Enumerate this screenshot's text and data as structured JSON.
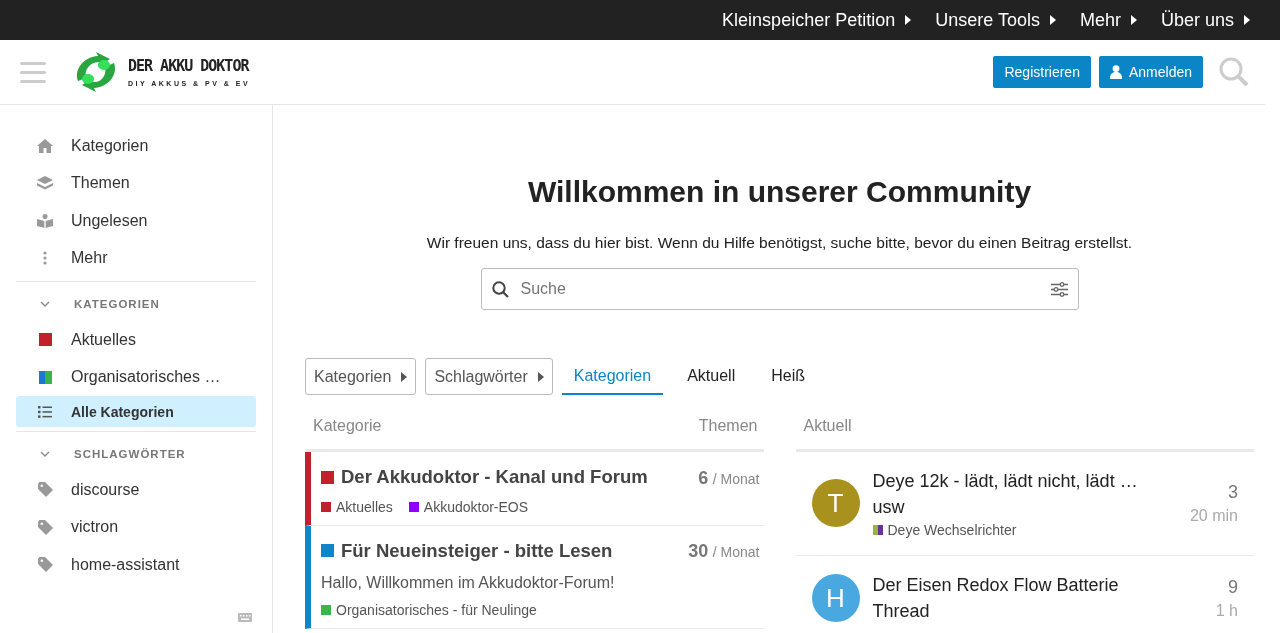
{
  "top_nav": [
    {
      "label": "Kleinspeicher Petition"
    },
    {
      "label": "Unsere Tools"
    },
    {
      "label": "Mehr"
    },
    {
      "label": "Über uns"
    }
  ],
  "header": {
    "logo_title": "DER AKKU DOKTOR",
    "logo_subtitle": "DIY AKKUS & PV & EV",
    "buttons": [
      {
        "label": "Registrieren",
        "kind": "plain"
      },
      {
        "label": "Anmelden",
        "kind": "user"
      }
    ]
  },
  "sidebar": {
    "items": [
      {
        "label": "Kategorien",
        "kind": "home"
      },
      {
        "label": "Themen",
        "kind": "layers"
      },
      {
        "label": "Ungelesen",
        "kind": "book"
      },
      {
        "label": "Mehr",
        "kind": "more"
      }
    ],
    "categories_heading": "KATEGORIEN",
    "categories": [
      {
        "label": "Aktuelles",
        "swatches": [
          {
            "color": "#c3202e"
          }
        ],
        "selected": false
      },
      {
        "label": "Organisatorisches …",
        "swatches": [
          {
            "color": "#1a7ad1"
          },
          {
            "color": "#3ab54a"
          }
        ],
        "selected": false
      },
      {
        "label": "Alle Kategorien",
        "selected": true
      }
    ],
    "tags_heading": "SCHLAGWÖRTER",
    "tags": [
      {
        "label": "discourse"
      },
      {
        "label": "victron"
      },
      {
        "label": "home-assistant"
      }
    ]
  },
  "welcome": {
    "title": "Willkommen in unserer Community",
    "text": "Wir freuen uns, dass du hier bist. Wenn du Hilfe benötigst, suche bitte, bevor du einen Beitrag erstellst.",
    "search_placeholder": "Suche"
  },
  "filters": [
    {
      "label": "Kategorien"
    },
    {
      "label": "Schlagwörter"
    }
  ],
  "tabs": [
    {
      "label": "Kategorien",
      "selected": true
    },
    {
      "label": "Aktuell",
      "selected": false
    },
    {
      "label": "Heiß",
      "selected": false
    }
  ],
  "categories_table": {
    "columns": [
      "Kategorie",
      "Themen"
    ],
    "rows": [
      {
        "title": "Der Akkudoktor - Kanal und Forum",
        "color": "#c3202e",
        "count": "6",
        "period": "/ Monat",
        "subcategories": [
          {
            "name": "Aktuelles",
            "color": "#c3202e"
          },
          {
            "name": "Akkudoktor-EOS",
            "color": "#8b00ff"
          }
        ]
      },
      {
        "title": "Für Neueinsteiger - bitte Lesen",
        "color": "#0e87c8",
        "count": "30",
        "period": "/ Monat",
        "description": "Hallo, Willkommen im Akkudoktor-Forum!",
        "subcategories": [
          {
            "name": "Organisatorisches - für Neulinge",
            "color": "#3ab54a"
          }
        ]
      }
    ]
  },
  "latest": {
    "heading": "Aktuell",
    "topics": [
      {
        "avatar": {
          "letter": "T",
          "color": "#a8911c"
        },
        "title": "Deye 12k - lädt, lädt nicht, lädt …",
        "title_line2": "usw",
        "category": "Deye Wechselrichter",
        "category_swatches": [
          {
            "color": "#9ab33a"
          },
          {
            "color": "#6d2f96"
          }
        ],
        "replies": "3",
        "time": "20 min"
      },
      {
        "avatar": {
          "letter": "H",
          "color": "#4aa8e0"
        },
        "title": "Der Eisen Redox Flow Batterie",
        "title_line2": "Thread",
        "replies": "9",
        "time": "1 h"
      }
    ]
  }
}
